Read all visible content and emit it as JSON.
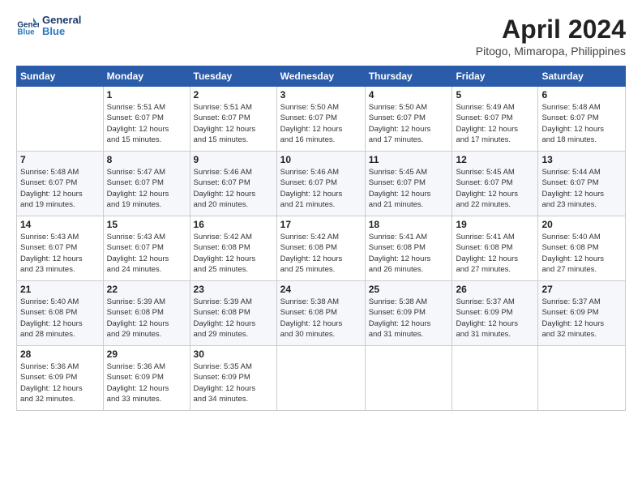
{
  "logo": {
    "line1": "General",
    "line2": "Blue"
  },
  "title": "April 2024",
  "location": "Pitogo, Mimaropa, Philippines",
  "days_of_week": [
    "Sunday",
    "Monday",
    "Tuesday",
    "Wednesday",
    "Thursday",
    "Friday",
    "Saturday"
  ],
  "weeks": [
    [
      {
        "day": "",
        "info": ""
      },
      {
        "day": "1",
        "info": "Sunrise: 5:51 AM\nSunset: 6:07 PM\nDaylight: 12 hours\nand 15 minutes."
      },
      {
        "day": "2",
        "info": "Sunrise: 5:51 AM\nSunset: 6:07 PM\nDaylight: 12 hours\nand 15 minutes."
      },
      {
        "day": "3",
        "info": "Sunrise: 5:50 AM\nSunset: 6:07 PM\nDaylight: 12 hours\nand 16 minutes."
      },
      {
        "day": "4",
        "info": "Sunrise: 5:50 AM\nSunset: 6:07 PM\nDaylight: 12 hours\nand 17 minutes."
      },
      {
        "day": "5",
        "info": "Sunrise: 5:49 AM\nSunset: 6:07 PM\nDaylight: 12 hours\nand 17 minutes."
      },
      {
        "day": "6",
        "info": "Sunrise: 5:48 AM\nSunset: 6:07 PM\nDaylight: 12 hours\nand 18 minutes."
      }
    ],
    [
      {
        "day": "7",
        "info": "Sunrise: 5:48 AM\nSunset: 6:07 PM\nDaylight: 12 hours\nand 19 minutes."
      },
      {
        "day": "8",
        "info": "Sunrise: 5:47 AM\nSunset: 6:07 PM\nDaylight: 12 hours\nand 19 minutes."
      },
      {
        "day": "9",
        "info": "Sunrise: 5:46 AM\nSunset: 6:07 PM\nDaylight: 12 hours\nand 20 minutes."
      },
      {
        "day": "10",
        "info": "Sunrise: 5:46 AM\nSunset: 6:07 PM\nDaylight: 12 hours\nand 21 minutes."
      },
      {
        "day": "11",
        "info": "Sunrise: 5:45 AM\nSunset: 6:07 PM\nDaylight: 12 hours\nand 21 minutes."
      },
      {
        "day": "12",
        "info": "Sunrise: 5:45 AM\nSunset: 6:07 PM\nDaylight: 12 hours\nand 22 minutes."
      },
      {
        "day": "13",
        "info": "Sunrise: 5:44 AM\nSunset: 6:07 PM\nDaylight: 12 hours\nand 23 minutes."
      }
    ],
    [
      {
        "day": "14",
        "info": "Sunrise: 5:43 AM\nSunset: 6:07 PM\nDaylight: 12 hours\nand 23 minutes."
      },
      {
        "day": "15",
        "info": "Sunrise: 5:43 AM\nSunset: 6:07 PM\nDaylight: 12 hours\nand 24 minutes."
      },
      {
        "day": "16",
        "info": "Sunrise: 5:42 AM\nSunset: 6:08 PM\nDaylight: 12 hours\nand 25 minutes."
      },
      {
        "day": "17",
        "info": "Sunrise: 5:42 AM\nSunset: 6:08 PM\nDaylight: 12 hours\nand 25 minutes."
      },
      {
        "day": "18",
        "info": "Sunrise: 5:41 AM\nSunset: 6:08 PM\nDaylight: 12 hours\nand 26 minutes."
      },
      {
        "day": "19",
        "info": "Sunrise: 5:41 AM\nSunset: 6:08 PM\nDaylight: 12 hours\nand 27 minutes."
      },
      {
        "day": "20",
        "info": "Sunrise: 5:40 AM\nSunset: 6:08 PM\nDaylight: 12 hours\nand 27 minutes."
      }
    ],
    [
      {
        "day": "21",
        "info": "Sunrise: 5:40 AM\nSunset: 6:08 PM\nDaylight: 12 hours\nand 28 minutes."
      },
      {
        "day": "22",
        "info": "Sunrise: 5:39 AM\nSunset: 6:08 PM\nDaylight: 12 hours\nand 29 minutes."
      },
      {
        "day": "23",
        "info": "Sunrise: 5:39 AM\nSunset: 6:08 PM\nDaylight: 12 hours\nand 29 minutes."
      },
      {
        "day": "24",
        "info": "Sunrise: 5:38 AM\nSunset: 6:08 PM\nDaylight: 12 hours\nand 30 minutes."
      },
      {
        "day": "25",
        "info": "Sunrise: 5:38 AM\nSunset: 6:09 PM\nDaylight: 12 hours\nand 31 minutes."
      },
      {
        "day": "26",
        "info": "Sunrise: 5:37 AM\nSunset: 6:09 PM\nDaylight: 12 hours\nand 31 minutes."
      },
      {
        "day": "27",
        "info": "Sunrise: 5:37 AM\nSunset: 6:09 PM\nDaylight: 12 hours\nand 32 minutes."
      }
    ],
    [
      {
        "day": "28",
        "info": "Sunrise: 5:36 AM\nSunset: 6:09 PM\nDaylight: 12 hours\nand 32 minutes."
      },
      {
        "day": "29",
        "info": "Sunrise: 5:36 AM\nSunset: 6:09 PM\nDaylight: 12 hours\nand 33 minutes."
      },
      {
        "day": "30",
        "info": "Sunrise: 5:35 AM\nSunset: 6:09 PM\nDaylight: 12 hours\nand 34 minutes."
      },
      {
        "day": "",
        "info": ""
      },
      {
        "day": "",
        "info": ""
      },
      {
        "day": "",
        "info": ""
      },
      {
        "day": "",
        "info": ""
      }
    ]
  ]
}
